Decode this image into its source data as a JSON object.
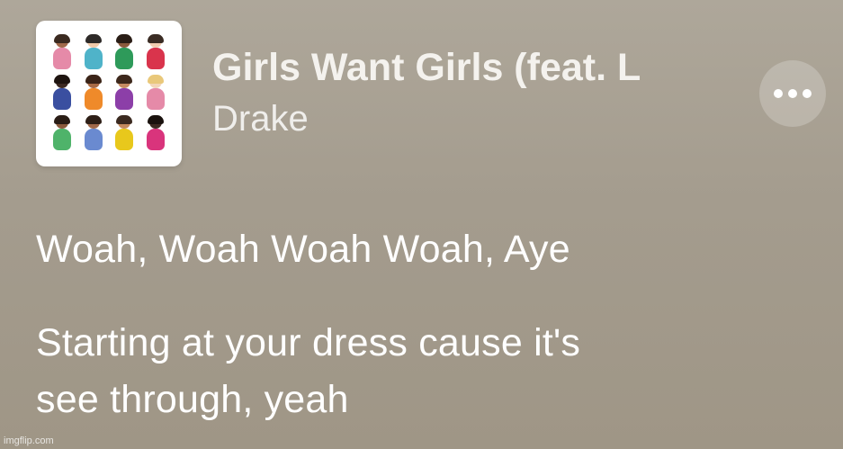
{
  "now_playing": {
    "title": "Girls Want Girls (feat. L",
    "artist": "Drake",
    "more_icon": "ellipsis-icon",
    "artwork": {
      "description_icon": "pregnant-woman-emoji-grid",
      "figures": [
        {
          "skin": "#a0694a",
          "hair": "#3b2a20",
          "body": "#e58aa8"
        },
        {
          "skin": "#f0c9a8",
          "hair": "#2e2a28",
          "body": "#4fb3c9"
        },
        {
          "skin": "#8a5a3c",
          "hair": "#2a1d16",
          "body": "#2e9a5a"
        },
        {
          "skin": "#f2cdb0",
          "hair": "#3a2c24",
          "body": "#d9344c"
        },
        {
          "skin": "#3d2a22",
          "hair": "#1e1410",
          "body": "#3a4fa0"
        },
        {
          "skin": "#a86a45",
          "hair": "#3b2418",
          "body": "#ef8a2a"
        },
        {
          "skin": "#c58b62",
          "hair": "#3d281c",
          "body": "#8c3fa8"
        },
        {
          "skin": "#f3d6b8",
          "hair": "#e9c87a",
          "body": "#e58aa8"
        },
        {
          "skin": "#8a5a3c",
          "hair": "#2a1d16",
          "body": "#4fb36a"
        },
        {
          "skin": "#a0694a",
          "hair": "#2e1f17",
          "body": "#6a8ad0"
        },
        {
          "skin": "#c48a5e",
          "hair": "#3b2a20",
          "body": "#e8c81c"
        },
        {
          "skin": "#3d2a22",
          "hair": "#1a120e",
          "body": "#d9347c"
        }
      ]
    }
  },
  "lyrics": {
    "line1": "Woah, Woah Woah Woah, Aye",
    "line2a": "Starting at your dress cause it's",
    "line2b": "see through, yeah"
  },
  "watermark": "imgflip.com"
}
